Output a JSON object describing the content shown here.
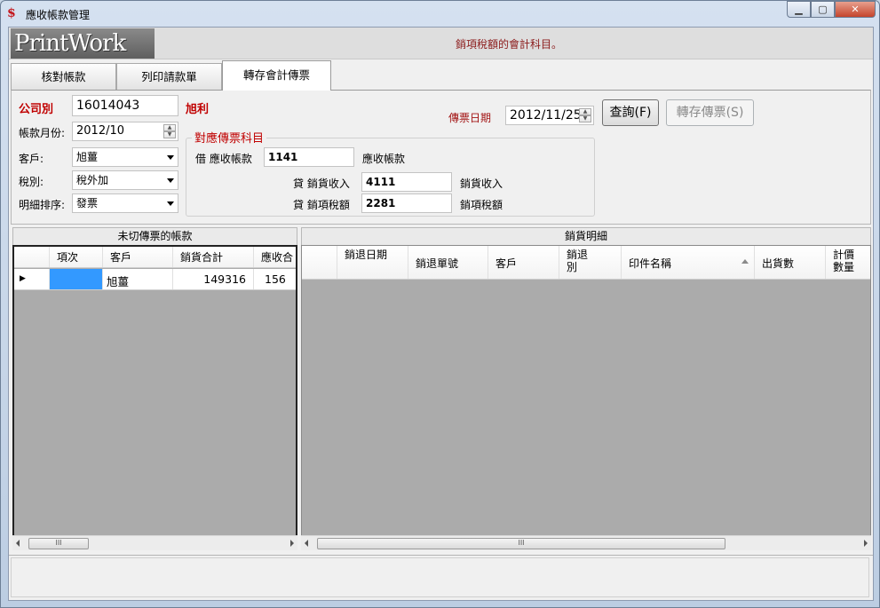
{
  "window": {
    "title": "應收帳款管理",
    "app_icon": "printwork-icon",
    "controls": {
      "minimize": "▁",
      "maximize": "▢",
      "close": "✕"
    }
  },
  "banner": {
    "logo": "PrintWork",
    "message": "銷項稅額的會計科目。"
  },
  "tabs": [
    {
      "label": "核對帳款",
      "active": false
    },
    {
      "label": "列印請款單",
      "active": false
    },
    {
      "label": "轉存會計傳票",
      "active": true
    }
  ],
  "form": {
    "company_label": "公司別",
    "company_value": "16014043",
    "company_name": "旭利",
    "period_label": "帳款月份:",
    "period_value": "2012/10",
    "customer_label": "客戶:",
    "customer_value": "旭薑",
    "tax_label": "稅別:",
    "tax_value": "稅外加",
    "sort_label": "明細排序:",
    "sort_value": "發票",
    "voucher_date_label": "傳票日期",
    "voucher_date_value": "2012/11/25",
    "query_button": "查詢(F)",
    "save_button": "轉存傳票(S)"
  },
  "accounts": {
    "title": "對應傳票科目",
    "debit_label": "借 應收帳款",
    "debit_code": "1141",
    "debit_name": "應收帳款",
    "credit1_label": "貸 銷貨收入",
    "credit1_code": "4111",
    "credit1_name": "銷貨收入",
    "credit2_label": "貸 銷項稅額",
    "credit2_code": "2281",
    "credit2_name": "銷項稅額"
  },
  "left_grid": {
    "title": "未切傳票的帳款",
    "columns": [
      "項次",
      "客戶",
      "銷貨合計",
      "應收合"
    ],
    "rows": [
      {
        "indicator": "▶",
        "index": "",
        "customer": "旭薑",
        "sales_total": "149316",
        "receivable_total": "156"
      }
    ]
  },
  "right_grid": {
    "title": "銷貨明細",
    "columns": [
      "銷退日期",
      "銷退單號",
      "客戶",
      "銷退別",
      "印件名稱",
      "出貨數",
      "計價數量"
    ]
  },
  "scrollbar": {
    "thumb_grip": "III"
  },
  "colors": {
    "accent_red": "#c00000",
    "selection_blue": "#3399ff",
    "grid_empty": "#ababab"
  }
}
